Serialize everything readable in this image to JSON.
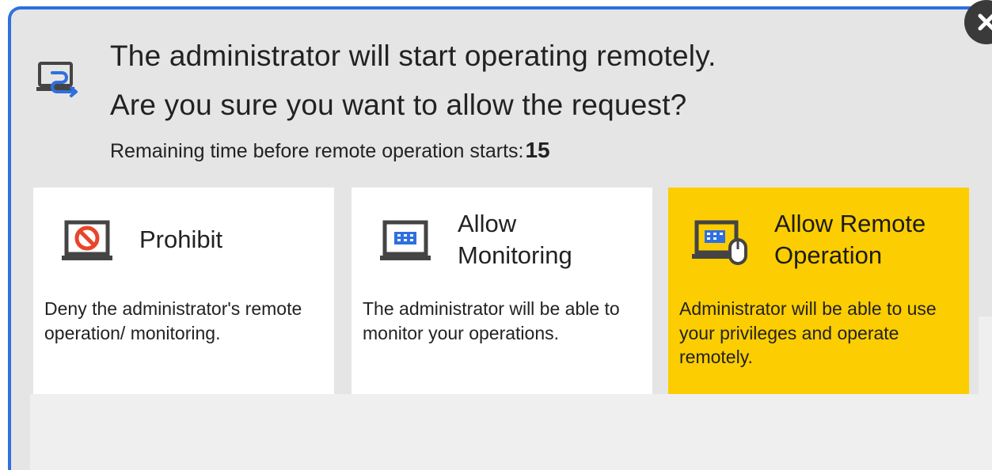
{
  "dialog": {
    "title_line1": "The administrator will start operating remotely.",
    "title_line2": "Are you sure you want to allow the request?",
    "remaining_label": "Remaining time before remote operation starts:",
    "remaining_count": "15",
    "header_icon": "remote-connection-icon",
    "close_icon": "close-icon"
  },
  "options": [
    {
      "id": "prohibit",
      "label": "Prohibit",
      "description": "Deny the administrator's remote operation/ monitoring.",
      "icon": "prohibit-monitor-icon"
    },
    {
      "id": "monitor",
      "label_line1": "Allow",
      "label_line2": "Monitoring",
      "description": "The administrator will be able to monitor your operations.",
      "icon": "monitor-icon"
    },
    {
      "id": "remote",
      "label_line1": "Allow Remote",
      "label_line2": "Operation",
      "description": "Administrator will be able to use your privileges and operate remotely.",
      "icon": "remote-operation-mouse-icon",
      "selected": true
    }
  ],
  "colors": {
    "accent_border": "#2f6fe0",
    "selected_card": "#fccd00",
    "dialog_bg": "#e5e5e5",
    "icon_blue": "#2f6fe0",
    "prohibit_red": "#e8452c"
  }
}
